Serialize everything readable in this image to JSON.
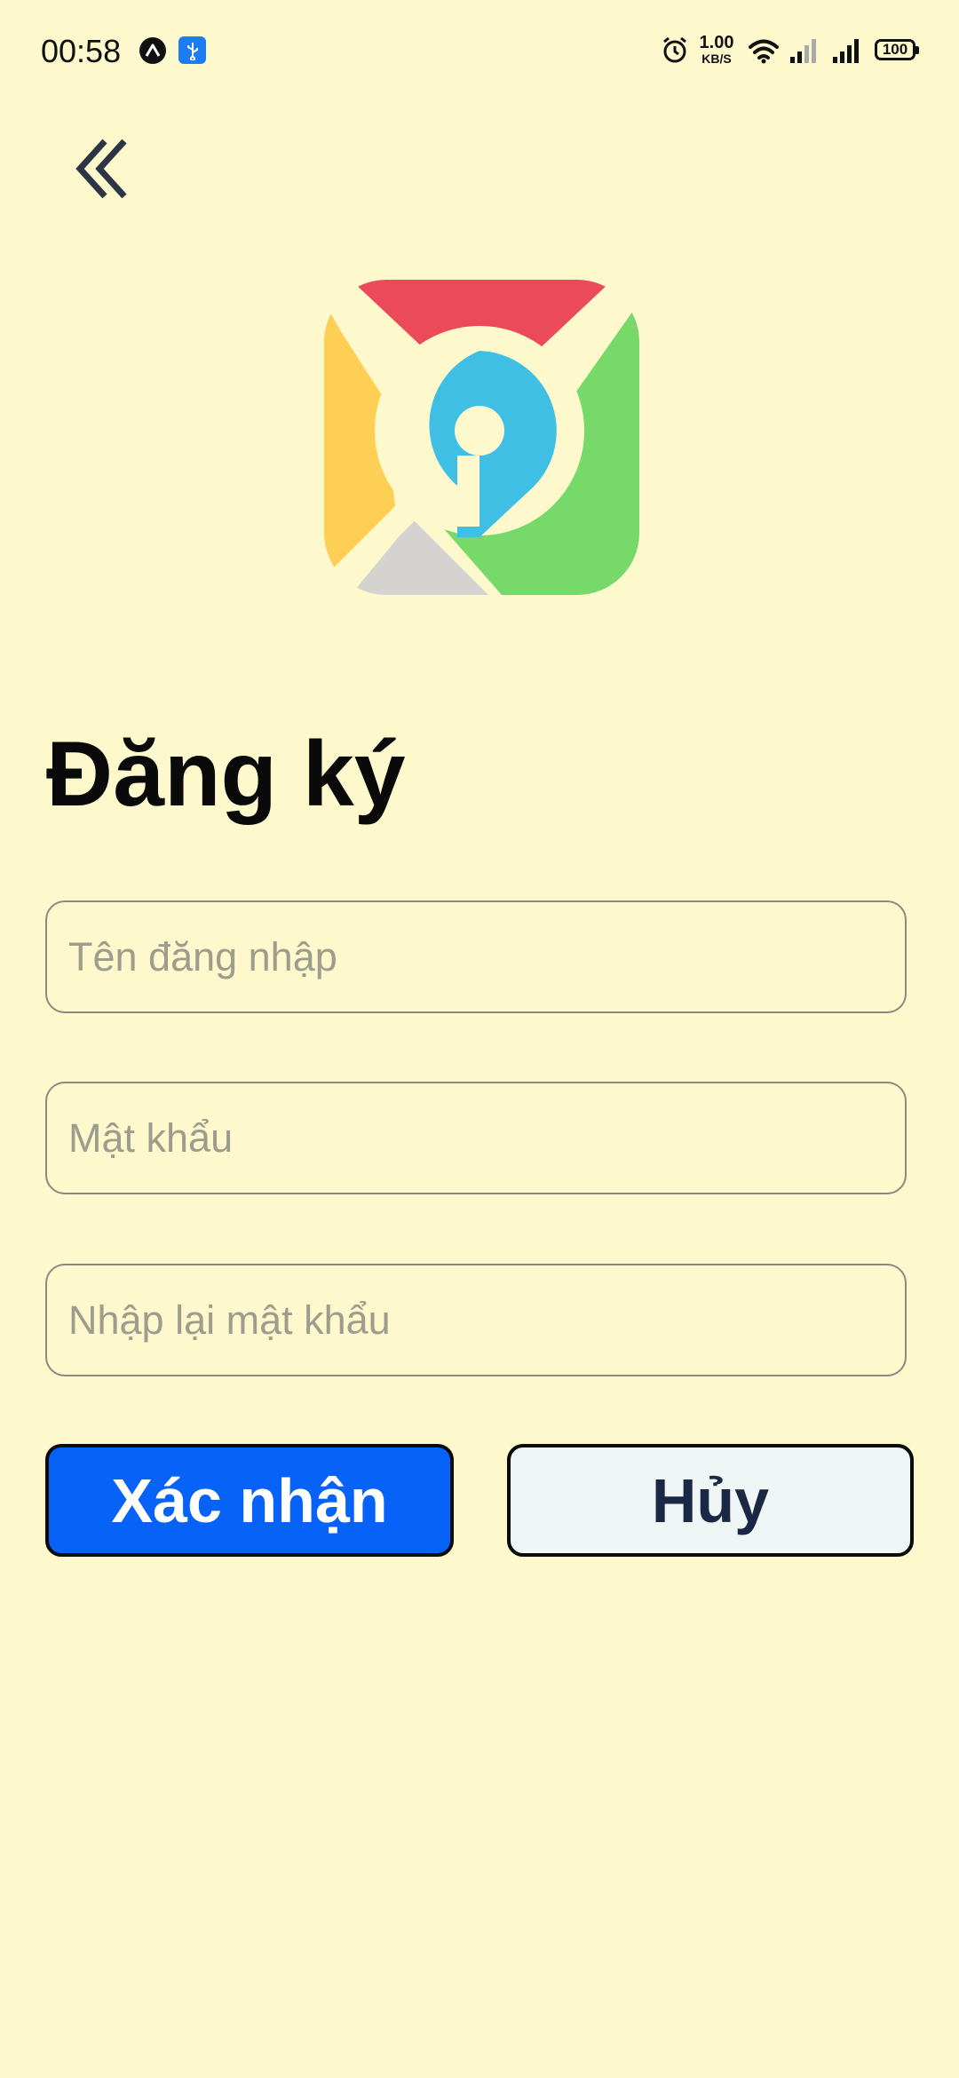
{
  "status_bar": {
    "time": "00:58",
    "net_speed_value": "1.00",
    "net_speed_unit": "KB/S",
    "battery": "100",
    "icons": [
      "app-notification-icon",
      "usb-icon",
      "alarm-icon",
      "wifi-icon",
      "signal-weak-icon",
      "signal-full-icon",
      "battery-icon"
    ]
  },
  "header": {
    "back_icon": "double-chevron-left-icon"
  },
  "logo": {
    "colors": {
      "red": "#EB4A5A",
      "yellow": "#FDD055",
      "green": "#77D96A",
      "gray": "#D5D3D0",
      "blue": "#40BFE4"
    }
  },
  "page": {
    "title": "Đăng ký"
  },
  "form": {
    "username_placeholder": "Tên đăng nhập",
    "password_placeholder": "Mật khẩu",
    "confirm_password_placeholder": "Nhập lại mật khẩu",
    "username_value": "",
    "password_value": "",
    "confirm_password_value": ""
  },
  "actions": {
    "confirm_label": "Xác nhận",
    "cancel_label": "Hủy"
  },
  "theme": {
    "background": "#FEF8CD",
    "primary": "#0762F8",
    "cancel_bg": "#EFF6F5"
  }
}
